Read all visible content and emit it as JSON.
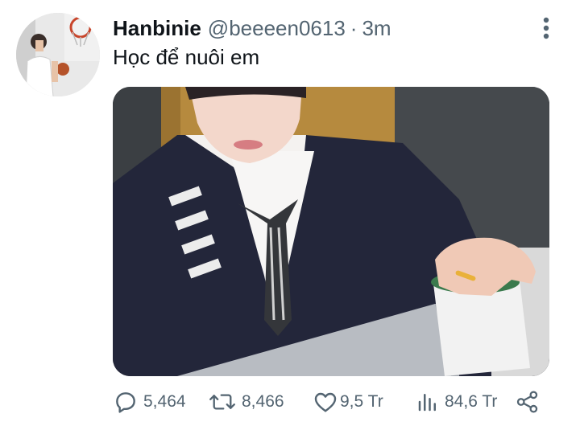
{
  "tweet": {
    "display_name": "Hanbinie",
    "handle": "@beeeen0613",
    "separator": "·",
    "time": "3m",
    "text": "Học để nuôi em"
  },
  "actions": {
    "reply_count": "5,464",
    "retweet_count": "8,466",
    "like_count": "9,5 Tr",
    "views_count": "84,6 Tr"
  },
  "icons": {
    "avatar": "profile-photo",
    "more": "more-vertical-icon",
    "reply": "reply-icon",
    "retweet": "retweet-icon",
    "like": "heart-icon",
    "views": "analytics-icon",
    "share": "share-icon"
  },
  "colors": {
    "text": "#0f1419",
    "secondary": "#536471",
    "background": "#ffffff"
  }
}
